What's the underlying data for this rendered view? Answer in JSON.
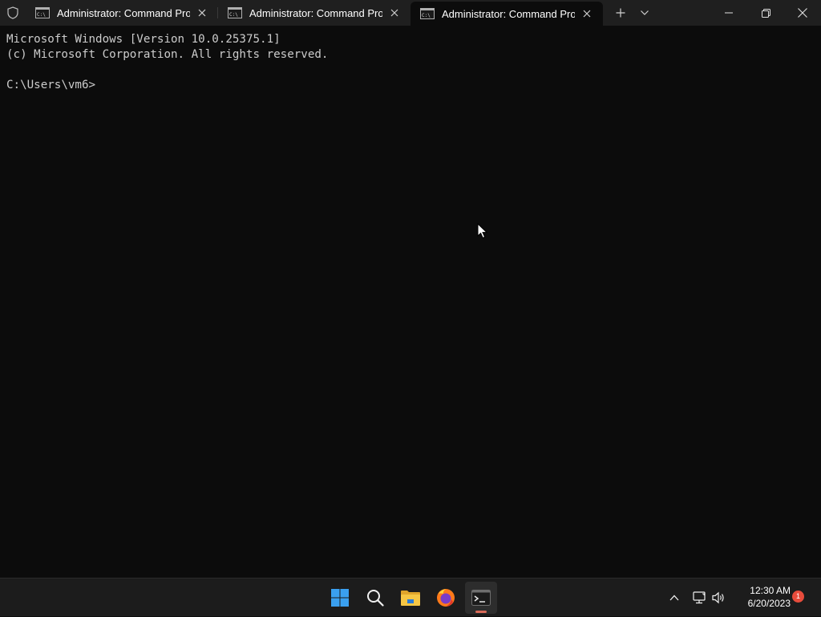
{
  "tabs": [
    {
      "title": "Administrator: Command Prompt",
      "active": false
    },
    {
      "title": "Administrator: Command Prompt",
      "active": false
    },
    {
      "title": "Administrator: Command Prompt",
      "active": true
    }
  ],
  "terminal": {
    "lines": [
      "Microsoft Windows [Version 10.0.25375.1]",
      "(c) Microsoft Corporation. All rights reserved.",
      "",
      "C:\\Users\\vm6>"
    ]
  },
  "taskbar": {
    "apps": [
      "start-icon",
      "search-icon",
      "file-explorer-icon",
      "firefox-icon",
      "terminal-icon"
    ],
    "active_app": "terminal-icon"
  },
  "tray": {
    "time": "12:30 AM",
    "date": "6/20/2023",
    "notification_count": "1"
  },
  "colors": {
    "terminal_bg": "#0c0c0c",
    "tabbar_bg": "#1f1f1f",
    "text": "#cccccc",
    "accent": "#d96b59",
    "badge": "#e74c3c"
  }
}
